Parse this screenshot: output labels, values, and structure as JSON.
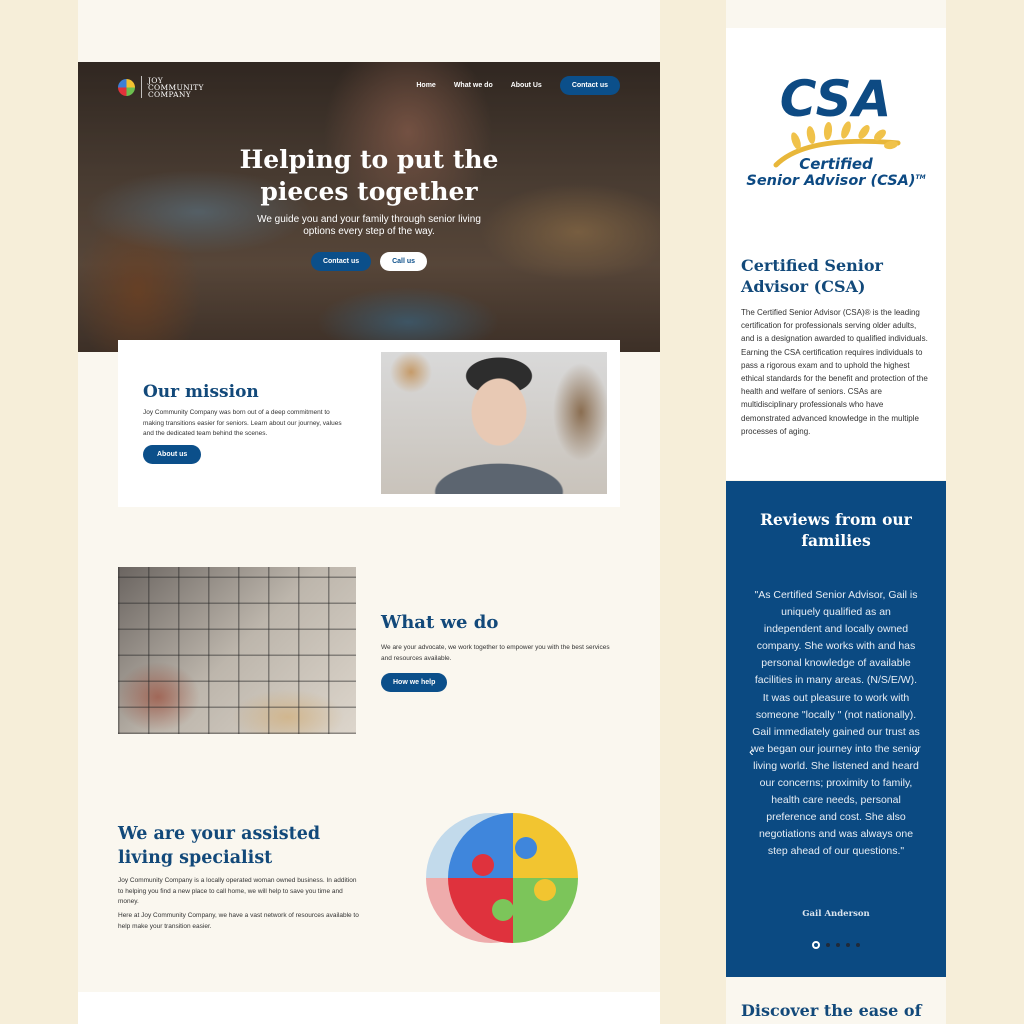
{
  "header": {
    "logo_lines": [
      "JOY",
      "COMMUNITY",
      "COMPANY"
    ],
    "nav": [
      {
        "label": "Home"
      },
      {
        "label": "What we do"
      },
      {
        "label": "About Us"
      },
      {
        "label": "Contact us"
      }
    ]
  },
  "hero": {
    "title_line1": "Helping to put the",
    "title_line2": "pieces together",
    "subtitle_line1": "We guide you and your family through senior living",
    "subtitle_line2": "options every step of the way.",
    "primary_button": "Contact us",
    "secondary_button": "Call us"
  },
  "mission": {
    "title": "Our mission",
    "text": "Joy Community Company was born out of a deep commitment to making transitions easier for seniors. Learn about our journey, values and the dedicated team behind the scenes.",
    "button": "About us"
  },
  "what_we_do": {
    "title": "What we do",
    "text": "We are your advocate, we work together to empower you with the best services and resources available.",
    "button": "How we help"
  },
  "specialist": {
    "title": "We are your assisted living specialist",
    "paragraph1": "Joy Community Company is a locally operated woman owned business. In addition to helping you find a new place to call home, we will help to save you time and money.",
    "paragraph2": "Here at Joy Community Company, we have a vast network of resources available to help make your transition easier."
  },
  "csa": {
    "logo_big": "CSA",
    "logo_line1": "Certified",
    "logo_line2": "Senior Advisor (CSA)",
    "logo_tm": "TM",
    "title": "Certified Senior Advisor (CSA)",
    "text": "The Certified Senior Advisor (CSA)® is the leading certification for professionals serving older adults, and is a designation awarded to qualified individuals. Earning the CSA certification requires individuals to pass a rigorous exam and to uphold the highest ethical standards for the benefit and protection of the health and welfare of seniors. CSAs are multidisciplinary professionals who have demonstrated advanced knowledge in the multiple processes of aging."
  },
  "reviews": {
    "title": "Reviews from our families",
    "quote": "\"As Certified Senior Advisor, Gail is uniquely qualified as an independent and locally owned company. She works with and has personal knowledge of available facilities in many areas. (N/S/E/W). It was out pleasure to work with someone \"locally \" (not nationally). Gail immediately gained our trust as we began our journey into the senior living world. She listened and heard our concerns; proximity to family, health care needs, personal preference and cost. She also negotiations and was always one step ahead of our questions.\"",
    "author": "Gail Anderson",
    "prev_icon": "‹",
    "next_icon": "›",
    "slide_count": 5,
    "active_slide": 1
  },
  "discover": {
    "title": "Discover the ease of"
  },
  "colors": {
    "brand_blue": "#0b4f8a",
    "heading_blue": "#12497a",
    "page_bg": "#f6eed9",
    "section_bg": "#faf7ef"
  }
}
